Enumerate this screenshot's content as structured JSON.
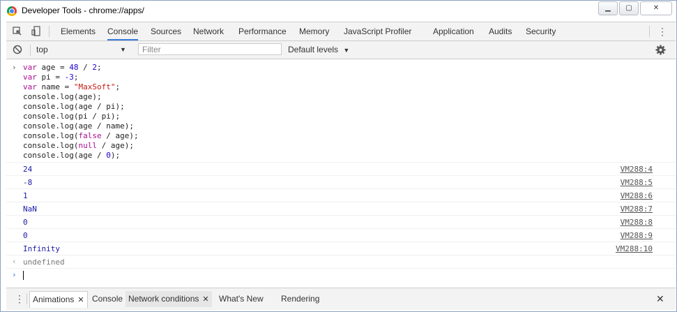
{
  "window": {
    "title": "Developer Tools - chrome://apps/"
  },
  "tabs": [
    "Elements",
    "Console",
    "Sources",
    "Network",
    "Performance",
    "Memory",
    "JavaScript Profiler",
    "Application",
    "Audits",
    "Security"
  ],
  "toolbar": {
    "context": "top",
    "filter_placeholder": "Filter",
    "levels": "Default levels"
  },
  "code": [
    [
      "kw:var ",
      "txt:age = ",
      "num:48",
      "txt: / ",
      "num:2",
      "txt:;"
    ],
    [
      "kw:var ",
      "txt:pi = ",
      "num:-3",
      "txt:;"
    ],
    [
      "kw:var ",
      "txt:name = ",
      "str:\"MaxSoft\"",
      "txt:;"
    ],
    [
      "txt:console.log(age);"
    ],
    [
      "txt:console.log(age / pi);"
    ],
    [
      "txt:console.log(pi / pi);"
    ],
    [
      "txt:console.log(age / name);"
    ],
    [
      "txt:console.log(",
      "kw:false",
      "txt: / age);"
    ],
    [
      "txt:console.log(",
      "kw:null",
      "txt: / age);"
    ],
    [
      "txt:console.log(age / ",
      "num:0",
      "txt:);"
    ]
  ],
  "outputs": [
    {
      "value": "24",
      "source": "VM288:4"
    },
    {
      "value": "-8",
      "source": "VM288:5"
    },
    {
      "value": "1",
      "source": "VM288:6"
    },
    {
      "value": "NaN",
      "source": "VM288:7"
    },
    {
      "value": "0",
      "source": "VM288:8"
    },
    {
      "value": "0",
      "source": "VM288:9"
    },
    {
      "value": "Infinity",
      "source": "VM288:10"
    }
  ],
  "result": "undefined",
  "drawer": [
    "Animations",
    "Console",
    "Network conditions",
    "What's New",
    "Rendering"
  ],
  "icons": [
    "chrome-icon",
    "inspect-icon",
    "device-icon",
    "clear-icon",
    "dropdown-icon",
    "gear-icon",
    "more-icon",
    "prompt-icon",
    "result-icon",
    "close-icon"
  ]
}
